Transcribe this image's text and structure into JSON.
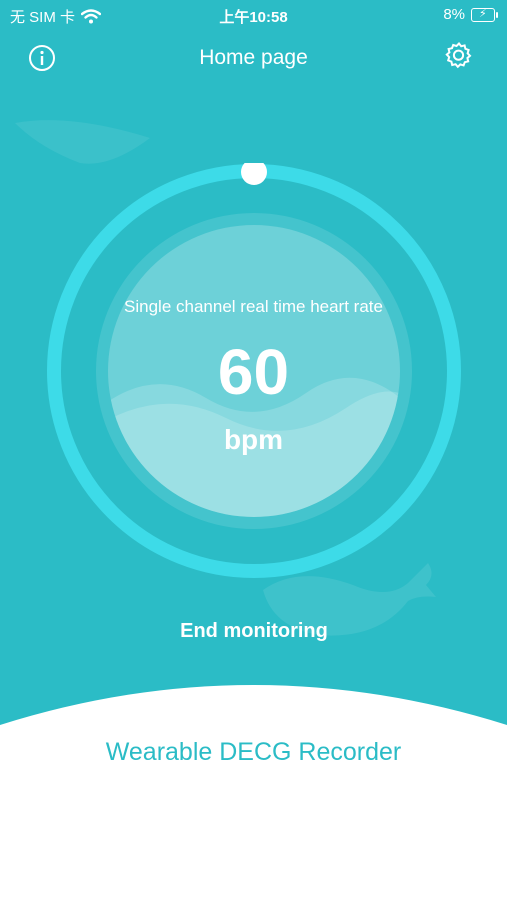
{
  "status_bar": {
    "carrier": "无 SIM 卡",
    "time": "上午10:58",
    "battery": "8%"
  },
  "header": {
    "title": "Home page"
  },
  "monitor": {
    "label": "Single channel real time heart rate",
    "value": "60",
    "unit": "bpm"
  },
  "actions": {
    "end_label": "End monitoring"
  },
  "footer": {
    "app_name": "Wearable DECG Recorder"
  },
  "colors": {
    "background": "#2bbcc6",
    "ring": "#3ddbe8",
    "white": "#ffffff"
  },
  "icons": {
    "info": "info-icon",
    "settings": "gear-icon",
    "wifi": "wifi-icon",
    "battery": "battery-icon"
  }
}
